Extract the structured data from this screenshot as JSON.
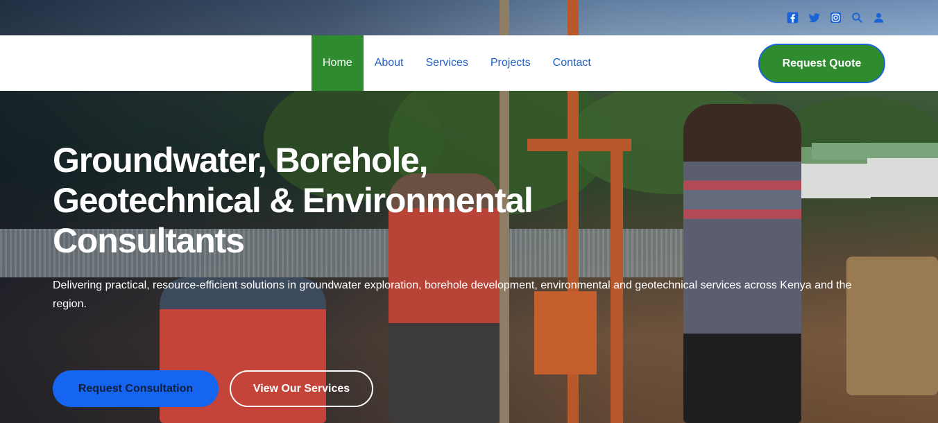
{
  "colors": {
    "brand_green": "#2e8b2e",
    "brand_blue": "#1565f0",
    "nav_link_blue": "#1f5fc9",
    "social_icon_blue": "#1a64d6"
  },
  "topbar": {
    "icons": [
      "facebook-icon",
      "twitter-icon",
      "instagram-icon",
      "search-icon",
      "user-icon"
    ]
  },
  "nav": {
    "items": [
      {
        "label": "Home",
        "active": true
      },
      {
        "label": "About"
      },
      {
        "label": "Services"
      },
      {
        "label": "Projects"
      },
      {
        "label": "Contact"
      }
    ],
    "cta_label": "Request Quote"
  },
  "hero": {
    "title_lines": [
      "Groundwater, Borehole,",
      "Geotechnical & Environmental",
      "Consultants"
    ],
    "subtitle": "Delivering practical, resource-efficient solutions in groundwater exploration, borehole development, environmental and geotechnical services across Kenya and the region.",
    "primary_button": "Request Consultation",
    "secondary_button": "View Our Services"
  }
}
